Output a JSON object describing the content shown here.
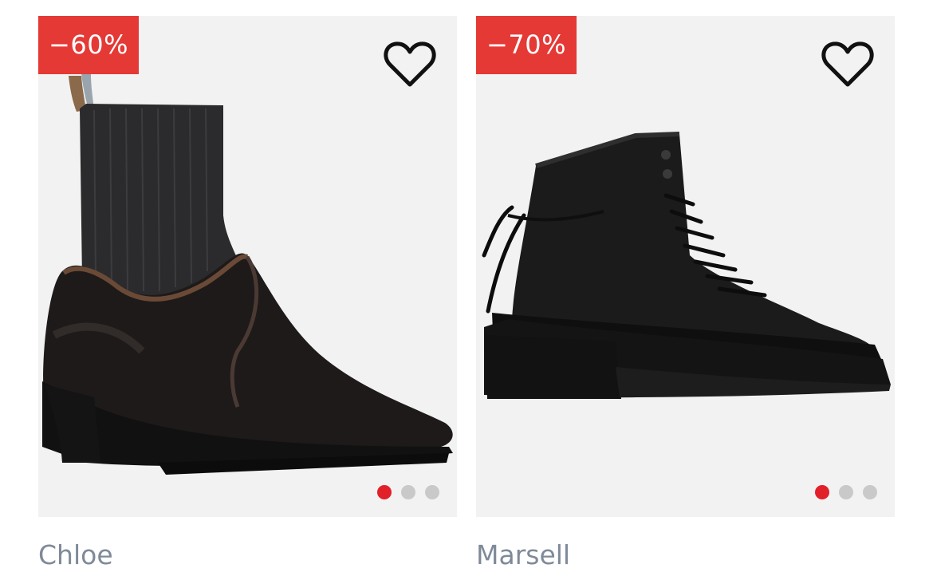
{
  "products": [
    {
      "discount": "−60%",
      "brand": "Chloe",
      "favorite_icon": "heart-outline-icon",
      "carousel": {
        "count": 3,
        "active": 1
      },
      "colors": {
        "badge": "#e53935",
        "active_dot": "#e2202a",
        "inactive_dot": "#c9c9c9"
      }
    },
    {
      "discount": "−70%",
      "brand": "Marsell",
      "favorite_icon": "heart-outline-icon",
      "carousel": {
        "count": 3,
        "active": 1
      },
      "colors": {
        "badge": "#e53935",
        "active_dot": "#e2202a",
        "inactive_dot": "#c9c9c9"
      }
    }
  ]
}
